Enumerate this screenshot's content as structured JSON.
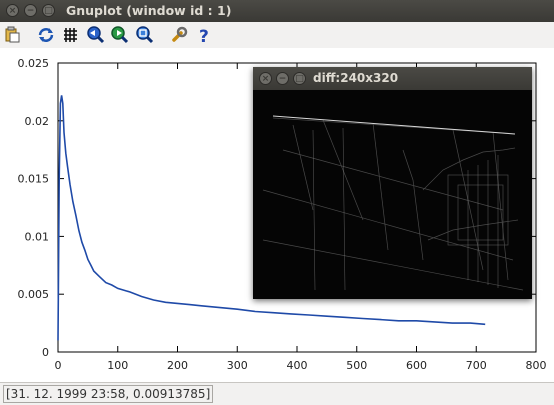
{
  "window": {
    "title": "Gnuplot (window id : 1)"
  },
  "toolbar": {
    "icons": [
      "copy-to-clipboard-icon",
      "replot-icon",
      "toggle-grid-icon",
      "zoom-previous-icon",
      "zoom-next-icon",
      "autoscale-icon",
      "options-wrench-icon",
      "help-icon"
    ]
  },
  "status": {
    "text": "[31. 12. 1999 23:58,  0.00913785]"
  },
  "diff_window": {
    "title": "diff:240x320"
  },
  "colors": {
    "series": "#1f4aa8",
    "titlebar": "#3c3b37",
    "toolbar_bg": "#f2f1f0"
  },
  "chart_data": {
    "type": "line",
    "title": "",
    "xlabel": "",
    "ylabel": "",
    "xlim": [
      0,
      800
    ],
    "ylim": [
      0,
      0.025
    ],
    "x_ticks": [
      "0",
      "100",
      "200",
      "300",
      "400",
      "500",
      "600",
      "700",
      "800"
    ],
    "y_ticks": [
      "0",
      "0.005",
      "0.01",
      "0.015",
      "0.02",
      "0.025"
    ],
    "grid": false,
    "series": [
      {
        "name": "",
        "x": [
          0,
          2,
          4,
          6,
          8,
          10,
          13,
          16,
          20,
          25,
          30,
          35,
          40,
          45,
          50,
          55,
          60,
          70,
          80,
          90,
          100,
          120,
          140,
          160,
          180,
          200,
          220,
          240,
          260,
          280,
          300,
          330,
          360,
          390,
          420,
          450,
          480,
          510,
          540,
          570,
          600,
          630,
          660,
          690,
          715
        ],
        "y": [
          0.001,
          0.015,
          0.0215,
          0.0222,
          0.0215,
          0.019,
          0.0172,
          0.016,
          0.0145,
          0.013,
          0.0118,
          0.0105,
          0.0095,
          0.0088,
          0.008,
          0.0075,
          0.007,
          0.0065,
          0.006,
          0.0058,
          0.0055,
          0.0052,
          0.0048,
          0.0045,
          0.0043,
          0.0042,
          0.0041,
          0.004,
          0.0039,
          0.0038,
          0.0037,
          0.0035,
          0.0034,
          0.0033,
          0.0032,
          0.0031,
          0.003,
          0.0029,
          0.0028,
          0.0027,
          0.0027,
          0.0026,
          0.0025,
          0.0025,
          0.0024
        ]
      }
    ]
  }
}
